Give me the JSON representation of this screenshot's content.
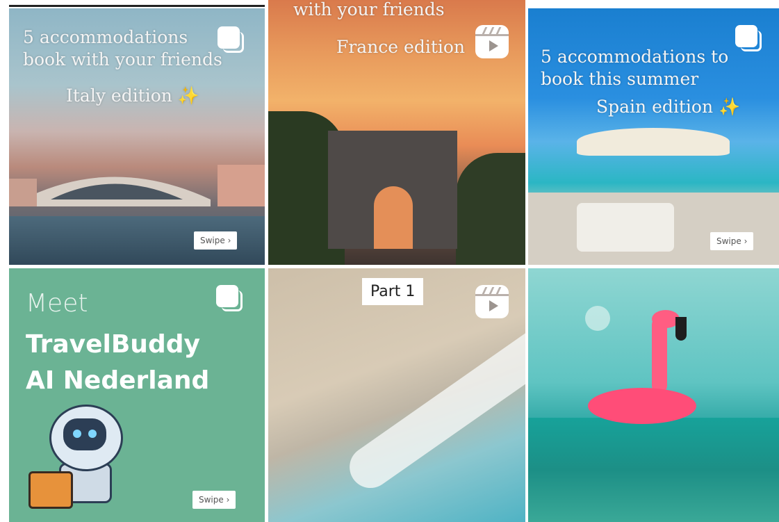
{
  "grid": {
    "tiles": [
      {
        "caption_lines": [
          "5 accommodations",
          "book with your friends"
        ],
        "edition": "Italy edition",
        "sparkle": "✨",
        "type_icon": "multi-image-icon",
        "swipe_label": "Swipe ›"
      },
      {
        "caption_lines": [
          "with your friends"
        ],
        "edition": "France edition",
        "type_icon": "reel-icon"
      },
      {
        "caption_lines": [
          "5 accommodations to",
          "book this summer"
        ],
        "edition": "Spain edition",
        "sparkle": "✨",
        "type_icon": "multi-image-icon",
        "swipe_label": "Swipe ›"
      },
      {
        "meet": "Meet",
        "brand_line1": "TravelBuddy",
        "brand_line2": "AI  Nederland",
        "type_icon": "multi-image-icon",
        "swipe_label": "Swipe ›"
      },
      {
        "label": "Part 1",
        "type_icon": "reel-icon"
      },
      {
        "type_icon": "none"
      }
    ]
  },
  "colors": {
    "mint_tile": "#6bb394",
    "sparkle": "#f3e36a"
  }
}
